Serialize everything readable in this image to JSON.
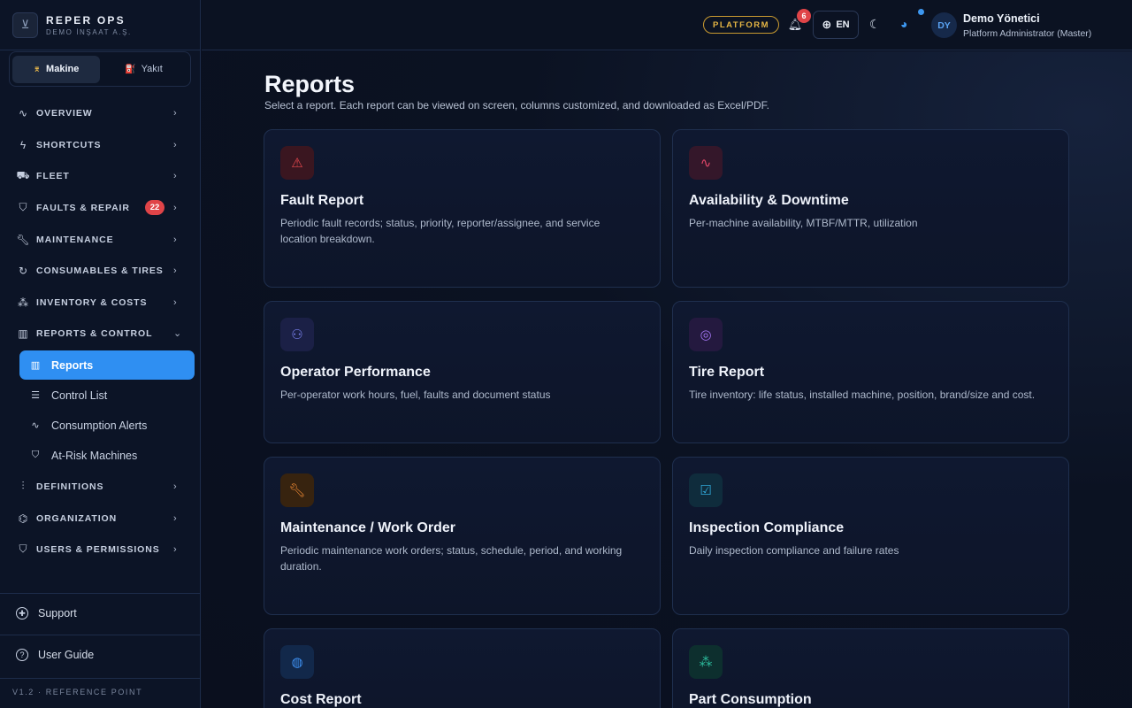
{
  "brand": {
    "name": "REPER OPS",
    "subtitle": "DEMO İNŞAAT A.Ş."
  },
  "mode_switch": [
    {
      "label": "Makine",
      "icon": "crane-icon",
      "active": true
    },
    {
      "label": "Yakıt",
      "icon": "fuel-icon",
      "active": false
    }
  ],
  "nav": [
    {
      "label": "OVERVIEW",
      "icon": "activity-icon"
    },
    {
      "label": "SHORTCUTS",
      "icon": "lightning-icon"
    },
    {
      "label": "FLEET",
      "icon": "truck-icon"
    },
    {
      "label": "FAULTS & REPAIR",
      "icon": "shield-icon",
      "badge": "22"
    },
    {
      "label": "MAINTENANCE",
      "icon": "wrench-icon"
    },
    {
      "label": "CONSUMABLES & TIRES",
      "icon": "cycle-icon"
    },
    {
      "label": "INVENTORY & COSTS",
      "icon": "boxes-icon"
    },
    {
      "label": "REPORTS & CONTROL",
      "icon": "bar-chart-icon",
      "expanded": true
    },
    {
      "label": "DEFINITIONS",
      "icon": "sliders-icon"
    },
    {
      "label": "ORGANIZATION",
      "icon": "org-chart-icon"
    },
    {
      "label": "USERS & PERMISSIONS",
      "icon": "shield-check-icon"
    }
  ],
  "reports_submenu": [
    {
      "label": "Reports",
      "icon": "bar-chart-icon",
      "active": true
    },
    {
      "label": "Control List",
      "icon": "checklist-icon"
    },
    {
      "label": "Consumption Alerts",
      "icon": "activity-icon"
    },
    {
      "label": "At-Risk Machines",
      "icon": "shield-icon"
    }
  ],
  "footer": {
    "support": "Support",
    "user_guide": "User Guide",
    "version": "V1.2 · REFERENCE POINT"
  },
  "header": {
    "platform_label": "PLATFORM",
    "notification_count": "6",
    "language": "EN",
    "avatar_initials": "DY",
    "user_name": "Demo Yönetici",
    "user_role": "Platform Administrator (Master)",
    "accent_color": "#3d97f0"
  },
  "page": {
    "title": "Reports",
    "description": "Select a report. Each report can be viewed on screen, columns customized, and downloaded as Excel/PDF."
  },
  "reports": [
    {
      "title": "Fault Report",
      "description": "Periodic fault records; status, priority, reporter/assignee, and service location breakdown.",
      "icon": "warning-icon",
      "color": "red"
    },
    {
      "title": "Availability & Downtime",
      "description": "Per-machine availability, MTBF/MTTR, utilization",
      "icon": "pulse-icon",
      "color": "rose"
    },
    {
      "title": "Operator Performance",
      "description": "Per-operator work hours, fuel, faults and document status",
      "icon": "users-icon",
      "color": "indigo"
    },
    {
      "title": "Tire Report",
      "description": "Tire inventory: life status, installed machine, position, brand/size and cost.",
      "icon": "tire-icon",
      "color": "violet"
    },
    {
      "title": "Maintenance / Work Order",
      "description": "Periodic maintenance work orders; status, schedule, period, and working duration.",
      "icon": "wrench-icon",
      "color": "orange"
    },
    {
      "title": "Inspection Compliance",
      "description": "Daily inspection compliance and failure rates",
      "icon": "clipboard-check-icon",
      "color": "cyan"
    },
    {
      "title": "Cost Report",
      "description": "",
      "icon": "coins-icon",
      "color": "blue"
    },
    {
      "title": "Part Consumption",
      "description": "",
      "icon": "boxes-icon",
      "color": "teal"
    }
  ]
}
